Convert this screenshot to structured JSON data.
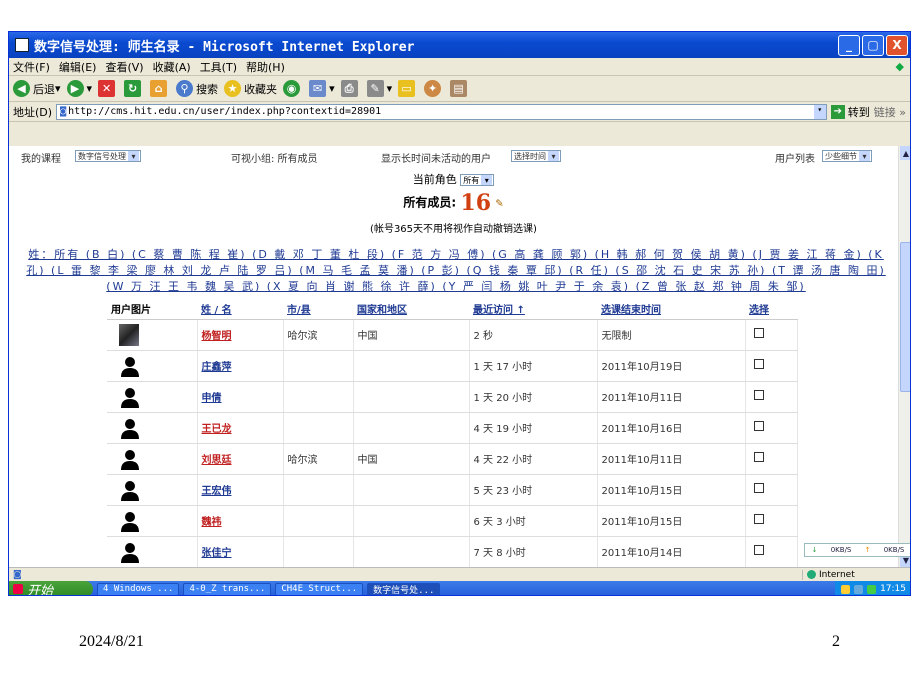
{
  "window": {
    "title": "数字信号处理: 师生名录 - Microsoft Internet Explorer",
    "controls": [
      "_",
      "▢",
      "X"
    ]
  },
  "menubar": [
    "文件(F)",
    "编辑(E)",
    "查看(V)",
    "收藏(A)",
    "工具(T)",
    "帮助(H)"
  ],
  "toolbar": {
    "back": "后退",
    "search": "搜索",
    "favorites": "收藏夹"
  },
  "addressbar": {
    "label": "地址(D)",
    "url": "http://cms.hit.edu.cn/user/index.php?contextid=28901",
    "go": "转到",
    "links": "链接 »"
  },
  "filters": {
    "my_course_label": "我的课程",
    "my_course_value": "数字信号处理",
    "visible_group": "可视小组: 所有成员",
    "inactive_label": "显示长时间未活动的用户",
    "inactive_value": "选择时间",
    "user_list_label": "用户列表",
    "user_list_value": "少些细节"
  },
  "role": {
    "label": "当前角色",
    "value": "所有"
  },
  "members": {
    "label": "所有成员:",
    "count": "16"
  },
  "note": "(帐号365天不用将视作自动撤销选课)",
  "alphabet_filter": "姓：所有 (B 白) (C 蔡 曹 陈 程 崔) (D 戴 邓 丁 董 杜 段) (F 范 方 冯 傅) (G 高 龚 顾 郭) (H 韩 郝 何 贺 侯 胡 黄) (J 贾 姜 江 蒋 金) (K 孔) (L 雷 黎 李 梁 廖 林 刘 龙 卢 陆 罗 吕) (M 马 毛 孟 莫 潘) (P 彭) (Q 钱 秦 覃 邱) (R 任) (S 邵 沈 石 史 宋 苏 孙) (T 谭 汤 唐 陶 田) (W 万 汪 王 韦 魏 吴 武) (X 夏 向 肖 谢 熊 徐 许 薛) (Y 严 闫 杨 姚 叶 尹 于 余 袁) (Z 曾 张 赵 郑 钟 周 朱 邹)",
  "table": {
    "headers": [
      "用户图片",
      "姓 / 名",
      "市/县",
      "国家和地区",
      "最近访问 ↑",
      "选课结束时间",
      "选择"
    ],
    "rows": [
      {
        "name": "杨智明",
        "city": "哈尔滨",
        "country": "中国",
        "last": "2 秒",
        "end": "无限制",
        "red": true,
        "photo": true
      },
      {
        "name": "庄鑫萍",
        "city": "",
        "country": "",
        "last": "1 天 17 小时",
        "end": "2011年10月19日",
        "red": false,
        "photo": false
      },
      {
        "name": "申倩",
        "city": "",
        "country": "",
        "last": "1 天 20 小时",
        "end": "2011年10月11日",
        "red": false,
        "photo": false
      },
      {
        "name": "王已龙",
        "city": "",
        "country": "",
        "last": "4 天 19 小时",
        "end": "2011年10月16日",
        "red": true,
        "photo": false
      },
      {
        "name": "刘思廷",
        "city": "哈尔滨",
        "country": "中国",
        "last": "4 天 22 小时",
        "end": "2011年10月11日",
        "red": true,
        "photo": false
      },
      {
        "name": "王宏伟",
        "city": "",
        "country": "",
        "last": "5 天 23 小时",
        "end": "2011年10月15日",
        "red": false,
        "photo": false
      },
      {
        "name": "魏祎",
        "city": "",
        "country": "",
        "last": "6 天 3 小时",
        "end": "2011年10月15日",
        "red": true,
        "photo": false
      },
      {
        "name": "张佳宁",
        "city": "",
        "country": "",
        "last": "7 天 8 小时",
        "end": "2011年10月14日",
        "red": false,
        "photo": false
      }
    ]
  },
  "netmeter": {
    "down": "0KB/S",
    "up": "0KB/S"
  },
  "statusbar": {
    "zone": "Internet"
  },
  "taskbar": {
    "start": "开始",
    "tasks": [
      "4 Windows ...",
      "4-0_Z trans...",
      "CH4E Struct...",
      "数字信号处..."
    ],
    "clock": "17:15"
  },
  "slide": {
    "date": "2024/8/21",
    "page": "2"
  }
}
